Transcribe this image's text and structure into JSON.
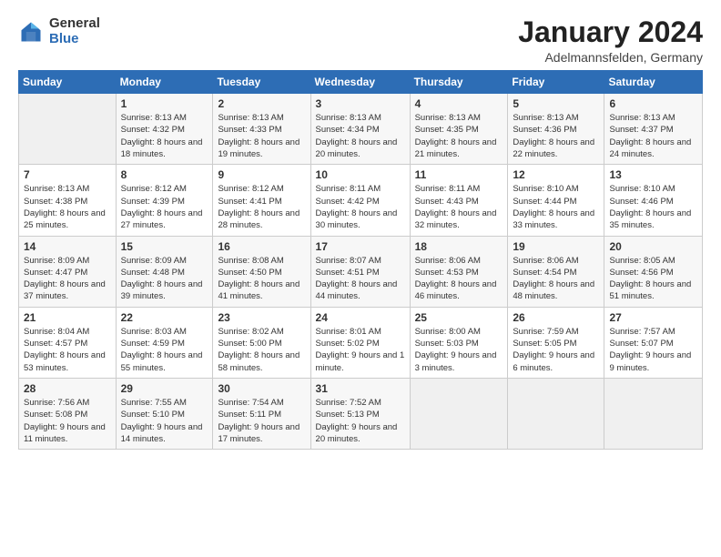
{
  "logo": {
    "general": "General",
    "blue": "Blue"
  },
  "header": {
    "title": "January 2024",
    "subtitle": "Adelmannsfelden, Germany"
  },
  "weekdays": [
    "Sunday",
    "Monday",
    "Tuesday",
    "Wednesday",
    "Thursday",
    "Friday",
    "Saturday"
  ],
  "weeks": [
    [
      {
        "day": "",
        "empty": true
      },
      {
        "day": "1",
        "sunrise": "Sunrise: 8:13 AM",
        "sunset": "Sunset: 4:32 PM",
        "daylight": "Daylight: 8 hours and 18 minutes."
      },
      {
        "day": "2",
        "sunrise": "Sunrise: 8:13 AM",
        "sunset": "Sunset: 4:33 PM",
        "daylight": "Daylight: 8 hours and 19 minutes."
      },
      {
        "day": "3",
        "sunrise": "Sunrise: 8:13 AM",
        "sunset": "Sunset: 4:34 PM",
        "daylight": "Daylight: 8 hours and 20 minutes."
      },
      {
        "day": "4",
        "sunrise": "Sunrise: 8:13 AM",
        "sunset": "Sunset: 4:35 PM",
        "daylight": "Daylight: 8 hours and 21 minutes."
      },
      {
        "day": "5",
        "sunrise": "Sunrise: 8:13 AM",
        "sunset": "Sunset: 4:36 PM",
        "daylight": "Daylight: 8 hours and 22 minutes."
      },
      {
        "day": "6",
        "sunrise": "Sunrise: 8:13 AM",
        "sunset": "Sunset: 4:37 PM",
        "daylight": "Daylight: 8 hours and 24 minutes."
      }
    ],
    [
      {
        "day": "7",
        "sunrise": "Sunrise: 8:13 AM",
        "sunset": "Sunset: 4:38 PM",
        "daylight": "Daylight: 8 hours and 25 minutes."
      },
      {
        "day": "8",
        "sunrise": "Sunrise: 8:12 AM",
        "sunset": "Sunset: 4:39 PM",
        "daylight": "Daylight: 8 hours and 27 minutes."
      },
      {
        "day": "9",
        "sunrise": "Sunrise: 8:12 AM",
        "sunset": "Sunset: 4:41 PM",
        "daylight": "Daylight: 8 hours and 28 minutes."
      },
      {
        "day": "10",
        "sunrise": "Sunrise: 8:11 AM",
        "sunset": "Sunset: 4:42 PM",
        "daylight": "Daylight: 8 hours and 30 minutes."
      },
      {
        "day": "11",
        "sunrise": "Sunrise: 8:11 AM",
        "sunset": "Sunset: 4:43 PM",
        "daylight": "Daylight: 8 hours and 32 minutes."
      },
      {
        "day": "12",
        "sunrise": "Sunrise: 8:10 AM",
        "sunset": "Sunset: 4:44 PM",
        "daylight": "Daylight: 8 hours and 33 minutes."
      },
      {
        "day": "13",
        "sunrise": "Sunrise: 8:10 AM",
        "sunset": "Sunset: 4:46 PM",
        "daylight": "Daylight: 8 hours and 35 minutes."
      }
    ],
    [
      {
        "day": "14",
        "sunrise": "Sunrise: 8:09 AM",
        "sunset": "Sunset: 4:47 PM",
        "daylight": "Daylight: 8 hours and 37 minutes."
      },
      {
        "day": "15",
        "sunrise": "Sunrise: 8:09 AM",
        "sunset": "Sunset: 4:48 PM",
        "daylight": "Daylight: 8 hours and 39 minutes."
      },
      {
        "day": "16",
        "sunrise": "Sunrise: 8:08 AM",
        "sunset": "Sunset: 4:50 PM",
        "daylight": "Daylight: 8 hours and 41 minutes."
      },
      {
        "day": "17",
        "sunrise": "Sunrise: 8:07 AM",
        "sunset": "Sunset: 4:51 PM",
        "daylight": "Daylight: 8 hours and 44 minutes."
      },
      {
        "day": "18",
        "sunrise": "Sunrise: 8:06 AM",
        "sunset": "Sunset: 4:53 PM",
        "daylight": "Daylight: 8 hours and 46 minutes."
      },
      {
        "day": "19",
        "sunrise": "Sunrise: 8:06 AM",
        "sunset": "Sunset: 4:54 PM",
        "daylight": "Daylight: 8 hours and 48 minutes."
      },
      {
        "day": "20",
        "sunrise": "Sunrise: 8:05 AM",
        "sunset": "Sunset: 4:56 PM",
        "daylight": "Daylight: 8 hours and 51 minutes."
      }
    ],
    [
      {
        "day": "21",
        "sunrise": "Sunrise: 8:04 AM",
        "sunset": "Sunset: 4:57 PM",
        "daylight": "Daylight: 8 hours and 53 minutes."
      },
      {
        "day": "22",
        "sunrise": "Sunrise: 8:03 AM",
        "sunset": "Sunset: 4:59 PM",
        "daylight": "Daylight: 8 hours and 55 minutes."
      },
      {
        "day": "23",
        "sunrise": "Sunrise: 8:02 AM",
        "sunset": "Sunset: 5:00 PM",
        "daylight": "Daylight: 8 hours and 58 minutes."
      },
      {
        "day": "24",
        "sunrise": "Sunrise: 8:01 AM",
        "sunset": "Sunset: 5:02 PM",
        "daylight": "Daylight: 9 hours and 1 minute."
      },
      {
        "day": "25",
        "sunrise": "Sunrise: 8:00 AM",
        "sunset": "Sunset: 5:03 PM",
        "daylight": "Daylight: 9 hours and 3 minutes."
      },
      {
        "day": "26",
        "sunrise": "Sunrise: 7:59 AM",
        "sunset": "Sunset: 5:05 PM",
        "daylight": "Daylight: 9 hours and 6 minutes."
      },
      {
        "day": "27",
        "sunrise": "Sunrise: 7:57 AM",
        "sunset": "Sunset: 5:07 PM",
        "daylight": "Daylight: 9 hours and 9 minutes."
      }
    ],
    [
      {
        "day": "28",
        "sunrise": "Sunrise: 7:56 AM",
        "sunset": "Sunset: 5:08 PM",
        "daylight": "Daylight: 9 hours and 11 minutes."
      },
      {
        "day": "29",
        "sunrise": "Sunrise: 7:55 AM",
        "sunset": "Sunset: 5:10 PM",
        "daylight": "Daylight: 9 hours and 14 minutes."
      },
      {
        "day": "30",
        "sunrise": "Sunrise: 7:54 AM",
        "sunset": "Sunset: 5:11 PM",
        "daylight": "Daylight: 9 hours and 17 minutes."
      },
      {
        "day": "31",
        "sunrise": "Sunrise: 7:52 AM",
        "sunset": "Sunset: 5:13 PM",
        "daylight": "Daylight: 9 hours and 20 minutes."
      },
      {
        "day": "",
        "empty": true
      },
      {
        "day": "",
        "empty": true
      },
      {
        "day": "",
        "empty": true
      }
    ]
  ]
}
